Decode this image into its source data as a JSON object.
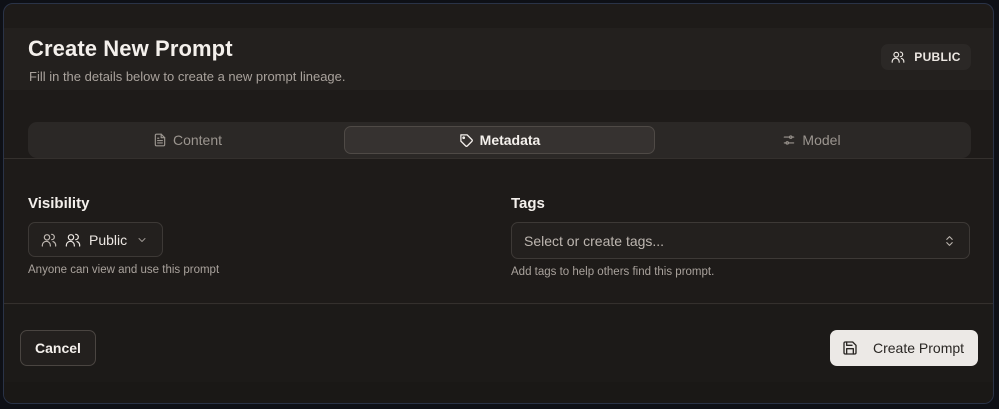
{
  "dialog": {
    "title": "Create New Prompt",
    "subtitle": "Fill in the details below to create a new prompt lineage.",
    "badge": {
      "label": "PUBLIC",
      "icon": "users-icon"
    }
  },
  "tabs": [
    {
      "label": "Content",
      "icon": "file-text-icon",
      "active": false
    },
    {
      "label": "Metadata",
      "icon": "tag-icon",
      "active": true
    },
    {
      "label": "Model",
      "icon": "sliders-icon",
      "active": false
    }
  ],
  "visibility": {
    "label": "Visibility",
    "selected": "Public",
    "helper": "Anyone can view and use this prompt"
  },
  "tags": {
    "label": "Tags",
    "placeholder": "Select or create tags...",
    "helper": "Add tags to help others find this prompt."
  },
  "footer": {
    "cancel_label": "Cancel",
    "create_label": "Create Prompt"
  },
  "colors": {
    "background": "#1e1b19",
    "accent_button": "#ece9e6",
    "border": "#2a3347"
  }
}
